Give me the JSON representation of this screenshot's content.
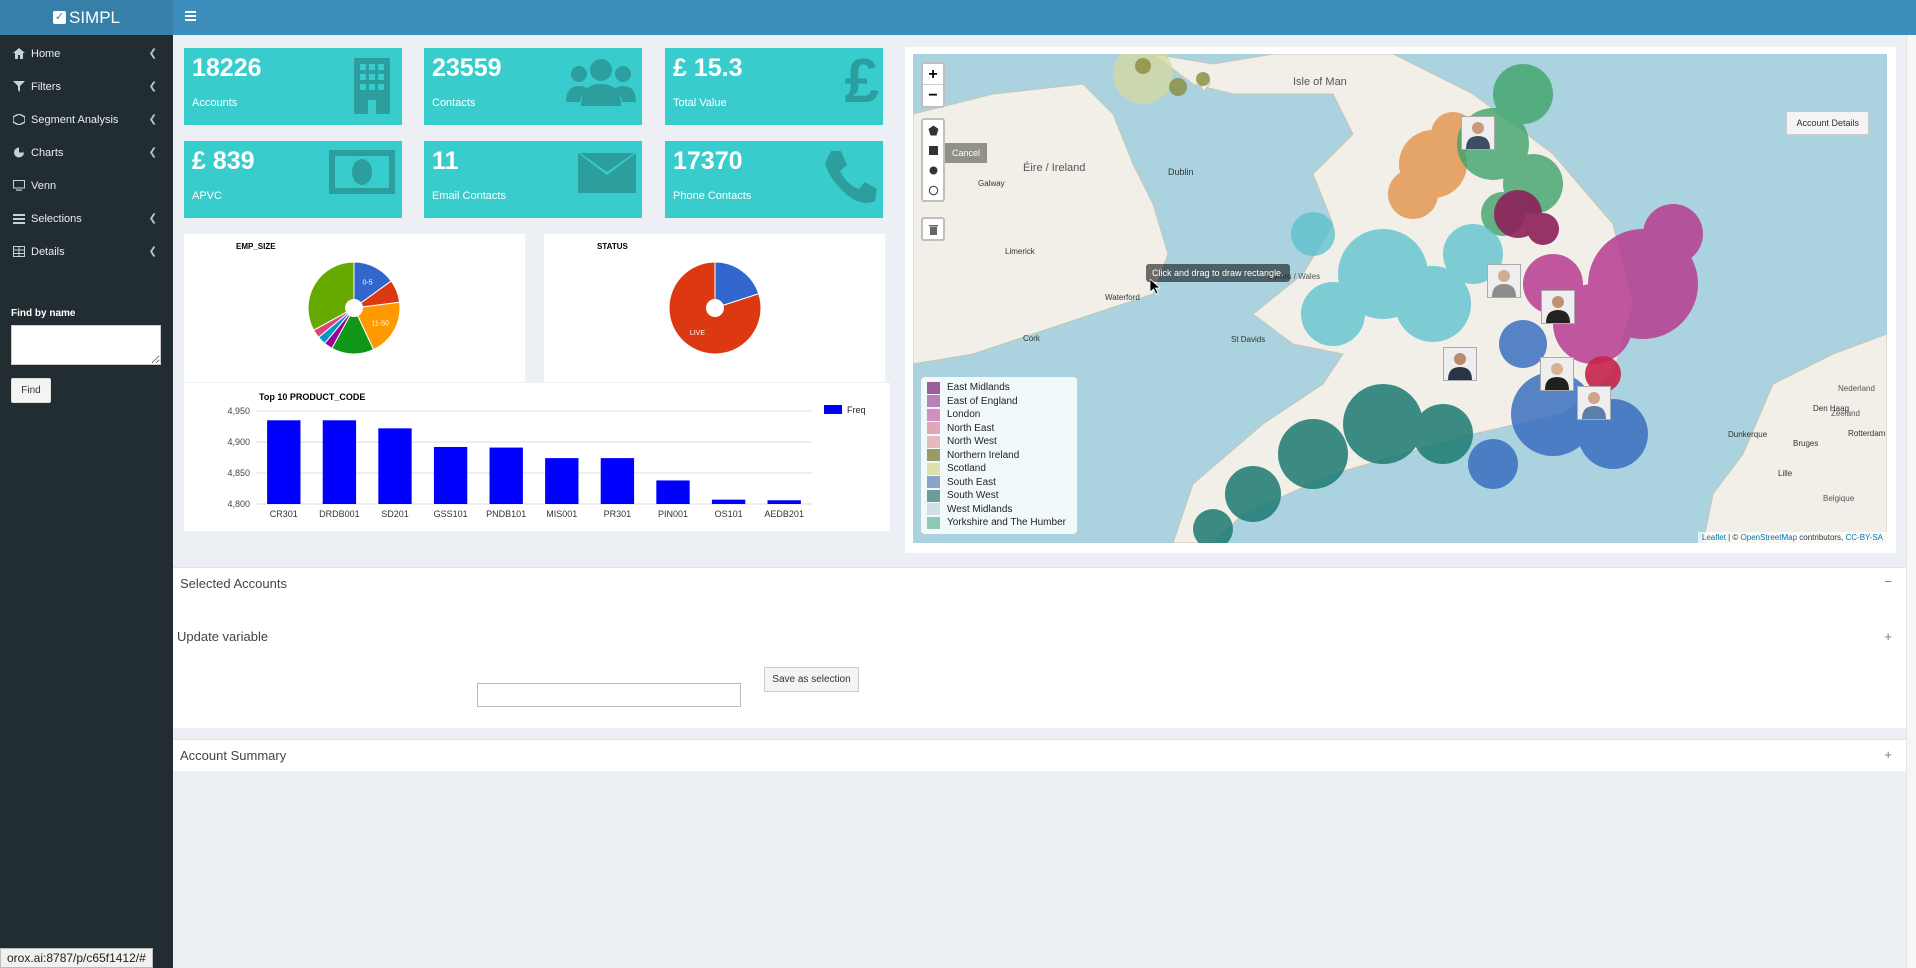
{
  "app": {
    "title": "SIMPL"
  },
  "sidebar": {
    "items": [
      {
        "label": "Home",
        "icon": "home-icon"
      },
      {
        "label": "Filters",
        "icon": "filter-icon"
      },
      {
        "label": "Segment Analysis",
        "icon": "cube-icon"
      },
      {
        "label": "Charts",
        "icon": "pie-icon"
      },
      {
        "label": "Venn",
        "icon": "monitor-icon"
      },
      {
        "label": "Selections",
        "icon": "list-icon"
      },
      {
        "label": "Details",
        "icon": "table-icon"
      }
    ],
    "find_label": "Find by name",
    "find_value": "",
    "find_button": "Find"
  },
  "value_boxes": [
    {
      "value": "18226",
      "label": "Accounts",
      "icon": "building-icon"
    },
    {
      "value": "23559",
      "label": "Contacts",
      "icon": "users-icon"
    },
    {
      "value": "£ 15.3",
      "label": "Total Value",
      "icon": "pound-icon"
    },
    {
      "value": "£ 839",
      "label": "APVC",
      "icon": "money-icon"
    },
    {
      "value": "11",
      "label": "Email Contacts",
      "icon": "envelope-icon"
    },
    {
      "value": "17370",
      "label": "Phone Contacts",
      "icon": "phone-icon"
    }
  ],
  "chart_data": [
    {
      "type": "pie",
      "title": "EMP_SIZE",
      "slices": [
        {
          "label": "0-5",
          "value": 15,
          "color": "#3366cc"
        },
        {
          "label": "",
          "value": 8,
          "color": "#dc3912"
        },
        {
          "label": "11-50",
          "value": 20,
          "color": "#ff9900"
        },
        {
          "label": "",
          "value": 15,
          "color": "#109618"
        },
        {
          "label": "",
          "value": 3,
          "color": "#990099"
        },
        {
          "label": "",
          "value": 3,
          "color": "#0099c6"
        },
        {
          "label": "",
          "value": 3,
          "color": "#dd4477"
        },
        {
          "label": "",
          "value": 33,
          "color": "#66aa00"
        }
      ]
    },
    {
      "type": "pie",
      "title": "STATUS",
      "slices": [
        {
          "label": "",
          "value": 20,
          "color": "#3366cc"
        },
        {
          "label": "LIVE",
          "value": 80,
          "color": "#dc3912"
        }
      ]
    },
    {
      "type": "bar",
      "title": "Top 10 PRODUCT_CODE",
      "categories": [
        "CR301",
        "DRDB001",
        "SD201",
        "GSS101",
        "PNDB101",
        "MIS001",
        "PR301",
        "PIN001",
        "OS101",
        "AEDB201"
      ],
      "series": [
        {
          "name": "Freq",
          "values": [
            4935,
            4935,
            4922,
            4892,
            4891,
            4874,
            4874,
            4838,
            4807,
            4806
          ],
          "color": "#0000ff"
        }
      ],
      "ylim": [
        4800,
        4950
      ],
      "yticks": [
        "4,800",
        "4,850",
        "4,900",
        "4,950"
      ]
    }
  ],
  "map": {
    "zoom_in": "+",
    "zoom_out": "−",
    "cancel_label": "Cancel",
    "tooltip": "Click and drag to draw rectangle.",
    "account_details_label": "Account Details",
    "attribution_leaflet": "Leaflet",
    "attribution_sep": " | © ",
    "attribution_osm": "OpenStreetMap",
    "attribution_mid": " contributors, ",
    "attribution_license": "CC-BY-SA",
    "place_labels": [
      "Isle of Man",
      "Éire / Ireland",
      "Dublin",
      "Galway",
      "Limerick",
      "Waterford",
      "Cork",
      "St Davids",
      "Cymru / Wales",
      "Nederland",
      "Zeeland",
      "Belgique",
      "Lille",
      "Dunkerque",
      "Bruges",
      "Den Haag",
      "Rotterdam"
    ],
    "legend": [
      {
        "label": "East Midlands",
        "color": "#9c5f9b"
      },
      {
        "label": "East of England",
        "color": "#b682b7"
      },
      {
        "label": "London",
        "color": "#cf8fbf"
      },
      {
        "label": "North East",
        "color": "#e2a6bb"
      },
      {
        "label": "North West",
        "color": "#e6b9c0"
      },
      {
        "label": "Northern Ireland",
        "color": "#9a9a67"
      },
      {
        "label": "Scotland",
        "color": "#dfdfb0"
      },
      {
        "label": "South East",
        "color": "#8aa3c8"
      },
      {
        "label": "South West",
        "color": "#6e9a9b"
      },
      {
        "label": "West Midlands",
        "color": "#d3dfe6"
      },
      {
        "label": "Yorkshire and The Humber",
        "color": "#8fc9b5"
      }
    ]
  },
  "sections": {
    "selected_accounts": "Selected Accounts",
    "update_variable": "Update variable",
    "save_selection": "Save as selection",
    "selection_value": "",
    "account_summary": "Account Summary",
    "collapse_symbol": "−",
    "expand_symbol": "+"
  },
  "statusbar": {
    "url": "orox.ai:8787/p/c65f1412/#"
  }
}
